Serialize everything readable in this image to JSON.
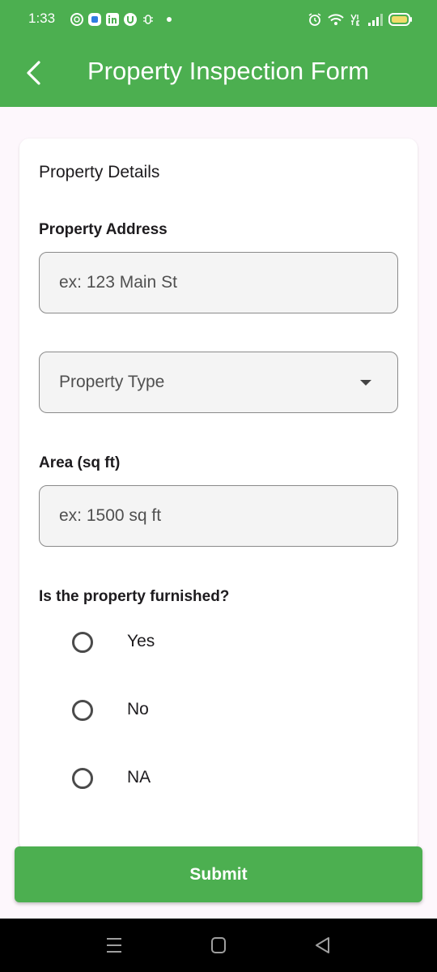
{
  "status_bar": {
    "time": "1:33",
    "notification_icons": [
      "openai-icon",
      "app-icon",
      "linkedin-icon",
      "u-icon",
      "bug-icon"
    ],
    "right_icons": [
      "alarm-icon",
      "wifi-icon",
      "volte-icon",
      "signal-icon",
      "battery-icon"
    ]
  },
  "app_bar": {
    "title": "Property Inspection Form",
    "back_icon": "chevron-left-icon"
  },
  "form": {
    "section_title": "Property Details",
    "address_label": "Property Address",
    "address_placeholder": "ex: 123 Main St",
    "property_type_placeholder": "Property Type",
    "area_label": "Area (sq ft)",
    "area_placeholder": "ex: 1500 sq ft",
    "furnished_question": "Is the property furnished?",
    "furnished_options": [
      "Yes",
      "No",
      "NA"
    ]
  },
  "submit_label": "Submit",
  "colors": {
    "primary": "#4caf50",
    "background": "#fdf7fc",
    "card": "#ffffff"
  }
}
